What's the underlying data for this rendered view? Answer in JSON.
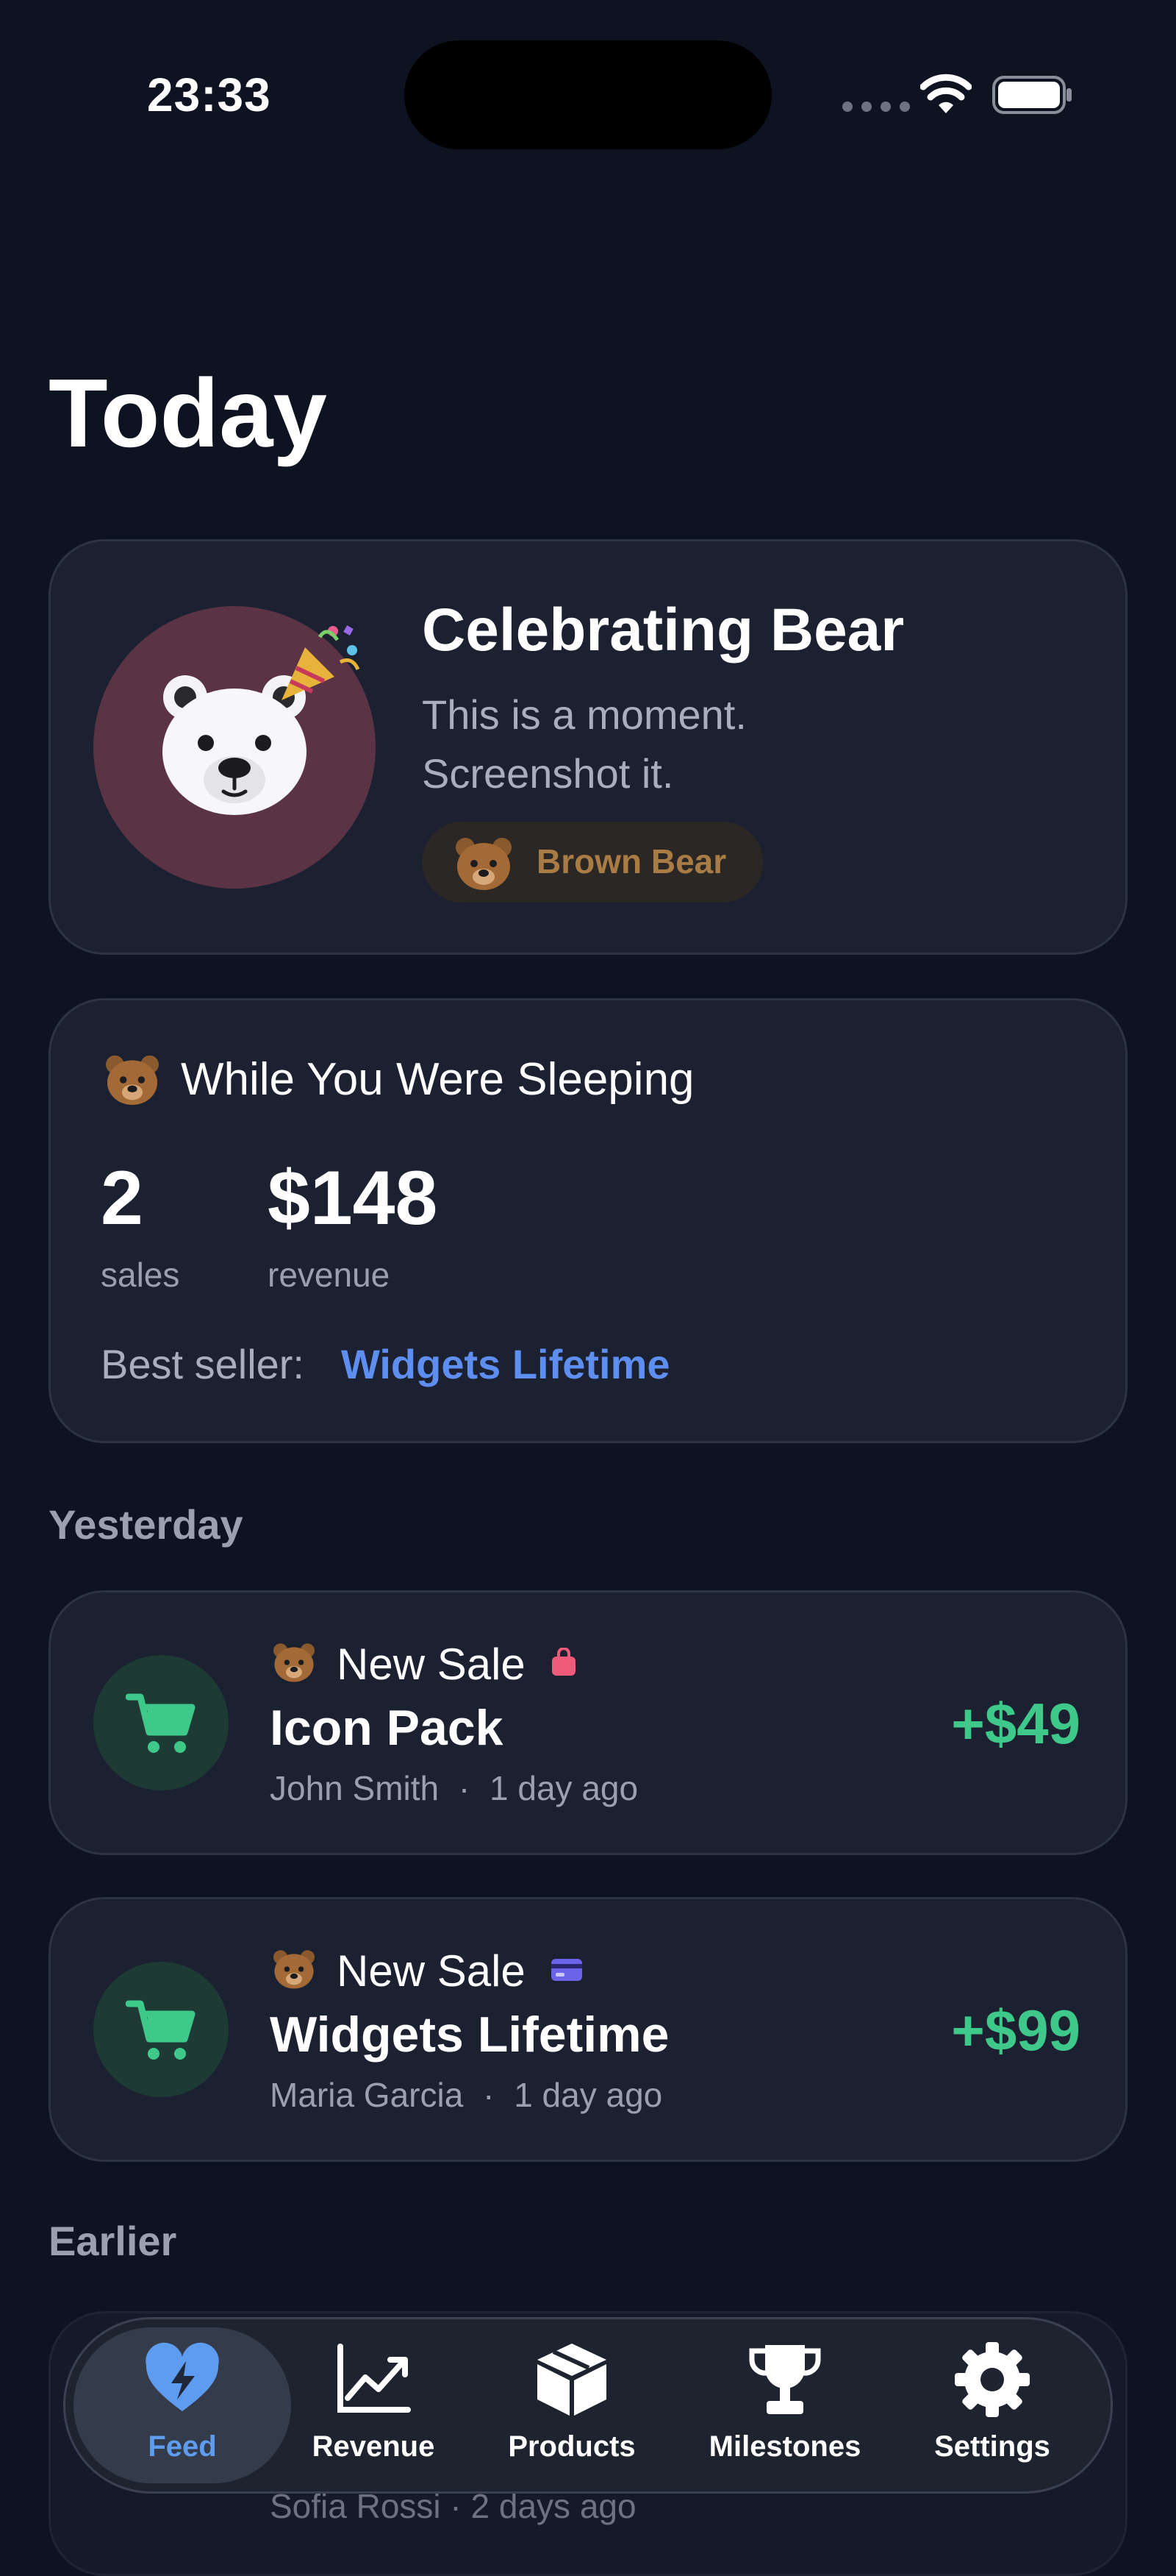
{
  "status_bar": {
    "time": "23:33"
  },
  "header": {
    "title": "Today"
  },
  "celebration": {
    "title": "Celebrating Bear",
    "subtitle_line1": "This is a moment.",
    "subtitle_line2": "Screenshot it.",
    "badge_label": "Brown Bear",
    "avatar_icon": "polar-bear-face",
    "accent_icon": "party-popper"
  },
  "sleeping": {
    "title": "While You Were Sleeping",
    "icon": "bear-face",
    "stats": [
      {
        "value": "2",
        "label": "sales"
      },
      {
        "value": "$148",
        "label": "revenue"
      }
    ],
    "best_seller_label": "Best seller:",
    "best_seller_value": "Widgets Lifetime"
  },
  "sections": {
    "yesterday": "Yesterday",
    "earlier": "Earlier"
  },
  "sales": [
    {
      "kind": "New Sale",
      "product": "Icon Pack",
      "customer": "John Smith",
      "separator": "·",
      "when": "1 day ago",
      "amount": "+$49",
      "tag_color": "#ef5b7a"
    },
    {
      "kind": "New Sale",
      "product": "Widgets Lifetime",
      "customer": "Maria Garcia",
      "separator": "·",
      "when": "1 day ago",
      "amount": "+$99",
      "tag_color": "#6b63e8"
    }
  ],
  "earlier_partial": {
    "meta": "Sofia Rossi · 2 days ago"
  },
  "tabs": [
    {
      "label": "Feed",
      "icon": "heart-bolt-icon",
      "active": true
    },
    {
      "label": "Revenue",
      "icon": "chart-line-icon",
      "active": false
    },
    {
      "label": "Products",
      "icon": "box-icon",
      "active": false
    },
    {
      "label": "Milestones",
      "icon": "trophy-icon",
      "active": false
    },
    {
      "label": "Settings",
      "icon": "gear-icon",
      "active": false
    }
  ],
  "colors": {
    "background": "#0e1321",
    "card": "#1b2130",
    "accent_blue": "#5e8ef0",
    "positive_green": "#3ec98a"
  }
}
